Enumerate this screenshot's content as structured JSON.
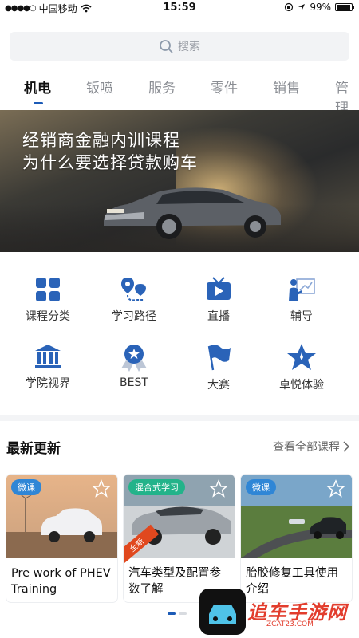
{
  "status_bar": {
    "carrier": "中国移动",
    "time": "15:59",
    "battery": "99%"
  },
  "search": {
    "placeholder": "搜索"
  },
  "tabs": [
    {
      "label": "机电",
      "active": true
    },
    {
      "label": "钣喷",
      "active": false
    },
    {
      "label": "服务",
      "active": false
    },
    {
      "label": "零件",
      "active": false
    },
    {
      "label": "销售",
      "active": false
    },
    {
      "label": "管理",
      "active": false
    }
  ],
  "banner": {
    "line1": "经销商金融内训课程",
    "line2": "为什么要选择贷款购车"
  },
  "categories": [
    {
      "label": "课程分类",
      "icon": "grid-icon"
    },
    {
      "label": "学习路径",
      "icon": "route-icon"
    },
    {
      "label": "直播",
      "icon": "tv-icon"
    },
    {
      "label": "辅导",
      "icon": "coach-icon"
    },
    {
      "label": "学院视界",
      "icon": "academy-icon"
    },
    {
      "label": "BEST",
      "icon": "medal-icon"
    },
    {
      "label": "大赛",
      "icon": "flag-icon"
    },
    {
      "label": "卓悦体验",
      "icon": "star-icon"
    }
  ],
  "latest": {
    "title": "最新更新",
    "view_all": "查看全部课程"
  },
  "courses": [
    {
      "badge": "微课",
      "badge_color": "#2f86d6",
      "title": "Pre work of PHEV Training"
    },
    {
      "badge": "混合式学习",
      "badge_color": "#23b38a",
      "title": "汽车类型及配置参数了解",
      "corner": "全新"
    },
    {
      "badge": "微课",
      "badge_color": "#2f86d6",
      "title": "胎胶修复工具使用介绍"
    }
  ],
  "watermark": {
    "text": "追车手游网",
    "sub": "ZCAT23.COM"
  },
  "colors": {
    "accent": "#1c5bb7",
    "icon_blue": "#2a63b8"
  }
}
